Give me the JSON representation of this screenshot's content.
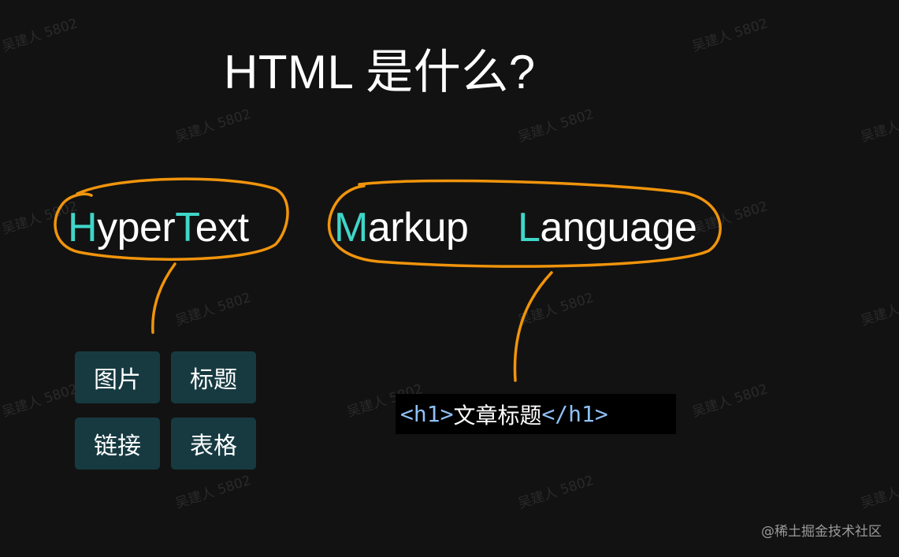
{
  "title": "HTML 是什么?",
  "terms": {
    "hypertext": {
      "hl1": "H",
      "part1": "yper",
      "hl2": "T",
      "part2": "ext"
    },
    "markup": {
      "hl": "M",
      "rest": "arkup"
    },
    "language": {
      "hl": "L",
      "rest": "anguage"
    }
  },
  "tags": [
    "图片",
    "标题",
    "链接",
    "表格"
  ],
  "code": {
    "open": "<h1>",
    "text": "文章标题",
    "close": "</h1>"
  },
  "watermark": "吴建人 5802",
  "credit": "@稀土掘金技术社区",
  "colors": {
    "background": "#121212",
    "highlight": "#3fd6c8",
    "annotation": "#f0940c",
    "tag_bg": "#173a41",
    "code_tag": "#8fc1f5"
  }
}
